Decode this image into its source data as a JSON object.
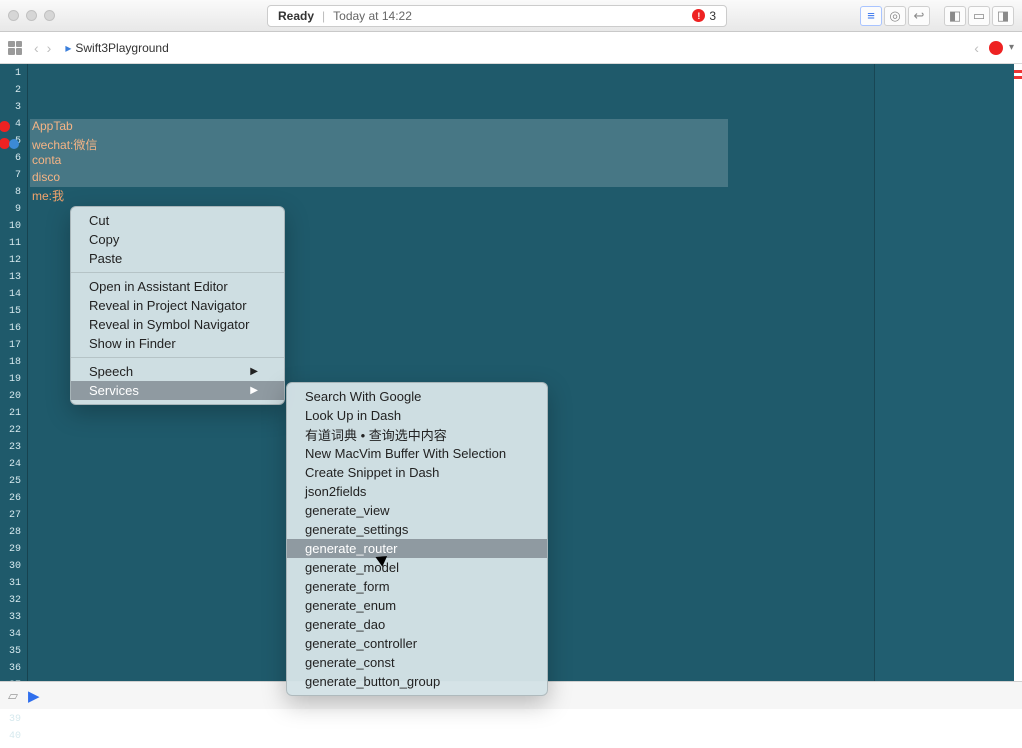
{
  "titlebar": {
    "status_ready": "Ready",
    "status_time": "Today at 14:22",
    "error_count": "3"
  },
  "pathbar": {
    "file": "Swift3Playground"
  },
  "code": {
    "lines": [
      "",
      "",
      "",
      "AppTab",
      "wechat:微信",
      "conta",
      "disco",
      "me:我"
    ]
  },
  "gutter": {
    "count": 40,
    "errors": [
      4,
      5
    ],
    "breakpoints": [
      5
    ]
  },
  "ctx_main": {
    "cut": "Cut",
    "copy": "Copy",
    "paste": "Paste",
    "open_assistant": "Open in Assistant Editor",
    "reveal_project": "Reveal in Project Navigator",
    "reveal_symbol": "Reveal in Symbol Navigator",
    "show_finder": "Show in Finder",
    "speech": "Speech",
    "services": "Services"
  },
  "ctx_services": [
    "Search With Google",
    "Look Up in Dash",
    "有道词典 • 查询选中内容",
    "New MacVim Buffer With Selection",
    "Create Snippet in Dash",
    "json2fields",
    "generate_view",
    "generate_settings",
    "generate_router",
    "generate_model",
    "generate_form",
    "generate_enum",
    "generate_dao",
    "generate_controller",
    "generate_const",
    "generate_button_group"
  ],
  "ctx_services_highlight_index": 8
}
